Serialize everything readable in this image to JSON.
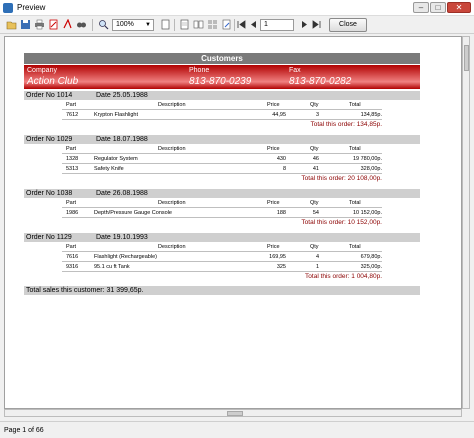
{
  "window": {
    "title": "Preview",
    "close_label": "Close"
  },
  "toolbar": {
    "zoom": "100%",
    "page": "1",
    "close_label": "Close"
  },
  "report": {
    "title": "Customers",
    "customer_labels": {
      "company": "Company",
      "phone": "Phone",
      "fax": "Fax"
    },
    "customer": {
      "company": "Action Club",
      "phone": "813-870-0239",
      "fax": "813-870-0282"
    },
    "columns": {
      "part": "Part",
      "description": "Description",
      "price": "Price",
      "qty": "Qty",
      "total": "Total"
    },
    "orders": [
      {
        "order": "Order No 1014",
        "date": "Date 25.05.1988",
        "items": [
          {
            "part": "7612",
            "description": "Krypton Flashlight",
            "price": "44,95",
            "qty": "3",
            "total": "134,85p."
          }
        ],
        "total": "Total this order: 134,85p."
      },
      {
        "order": "Order No 1029",
        "date": "Date 18.07.1988",
        "items": [
          {
            "part": "1328",
            "description": "Regulator System",
            "price": "430",
            "qty": "46",
            "total": "19 780,00p."
          },
          {
            "part": "5313",
            "description": "Safety Knife",
            "price": "8",
            "qty": "41",
            "total": "328,00p."
          }
        ],
        "total": "Total this order: 20 108,00p."
      },
      {
        "order": "Order No 1038",
        "date": "Date 26.08.1988",
        "items": [
          {
            "part": "1986",
            "description": "Depth/Pressure Gauge Console",
            "price": "188",
            "qty": "54",
            "total": "10 152,00p."
          }
        ],
        "total": "Total this order: 10 152,00p."
      },
      {
        "order": "Order No 1129",
        "date": "Date 19.10.1993",
        "items": [
          {
            "part": "7616",
            "description": "Flashlight (Rechargeable)",
            "price": "169,95",
            "qty": "4",
            "total": "679,80p."
          },
          {
            "part": "9316",
            "description": "95.1 cu ft Tank",
            "price": "325",
            "qty": "1",
            "total": "325,00p."
          }
        ],
        "total": "Total this order: 1 004,80p."
      }
    ],
    "grand_total": "Total sales this customer: 31 399,65p."
  },
  "status": {
    "page_info": "Page 1 of 66"
  },
  "colors": {
    "band": "#b00000",
    "total_text": "#8b0000",
    "order_band": "#cfcfcf",
    "title_band": "#7a7a7a"
  }
}
